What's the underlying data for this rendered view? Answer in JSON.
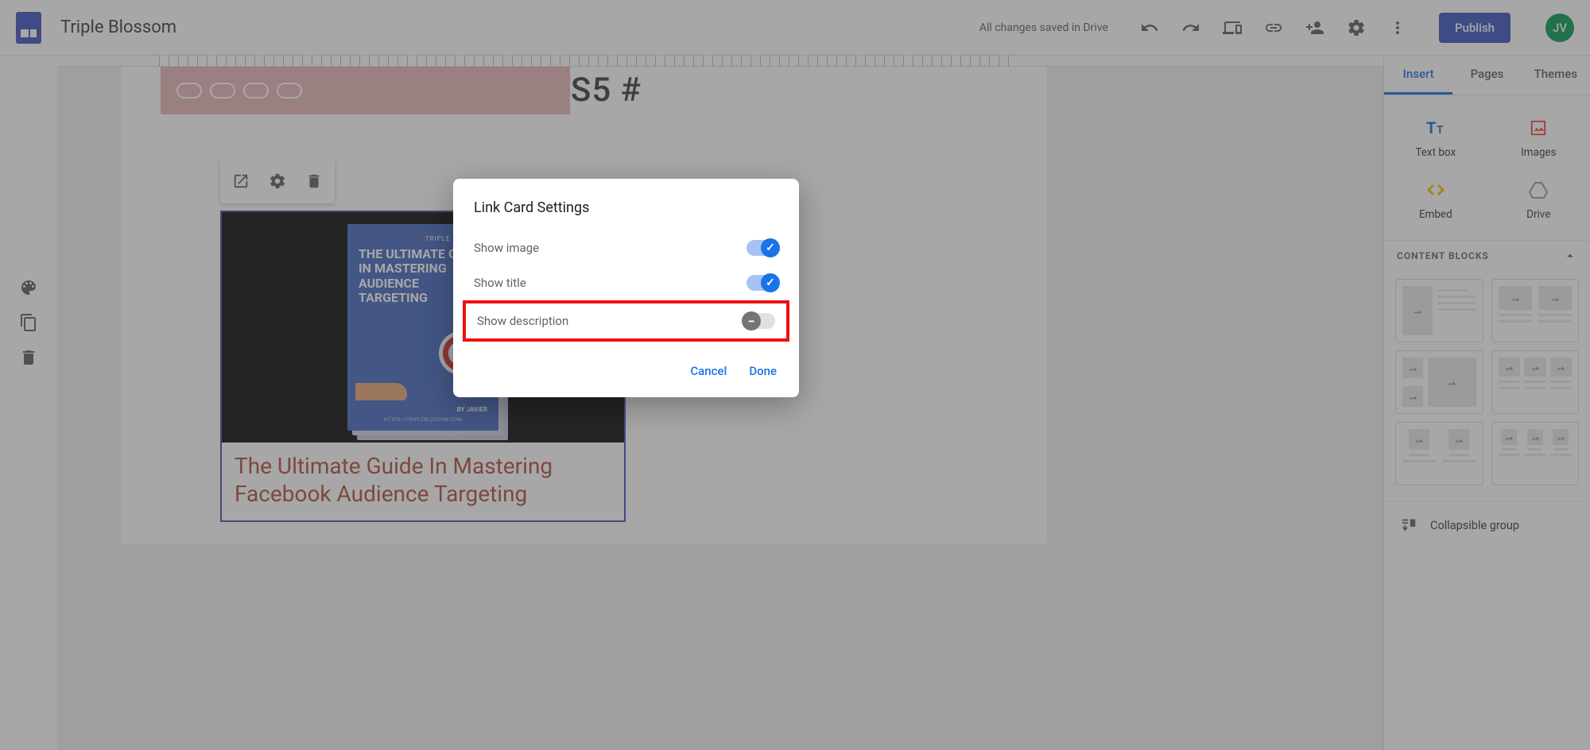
{
  "header": {
    "title": "Triple Blossom",
    "save_status": "All changes saved in Drive",
    "publish_label": "Publish",
    "avatar_initials": "JV"
  },
  "canvas": {
    "section_label": "S5 #",
    "link_card": {
      "book_brand": "TRIPLE BLOSSOM",
      "book_title": "THE ULTIMATE GUIDE IN MASTERING AUDIENCE TARGETING",
      "book_byline": "BY JAVIER",
      "book_url": "HTTPS://TRIPLEBLOSSOM.COM",
      "title": "The Ultimate Guide In Mastering Facebook Audience Targeting"
    }
  },
  "dialog": {
    "title": "Link Card Settings",
    "show_image": "Show image",
    "show_title": "Show title",
    "show_description": "Show description",
    "cancel": "Cancel",
    "done": "Done"
  },
  "right_panel": {
    "tabs": {
      "insert": "Insert",
      "pages": "Pages",
      "themes": "Themes"
    },
    "insert_items": {
      "text_box": "Text box",
      "images": "Images",
      "embed": "Embed",
      "drive": "Drive"
    },
    "content_blocks_header": "CONTENT BLOCKS",
    "collapsible_group": "Collapsible group"
  }
}
